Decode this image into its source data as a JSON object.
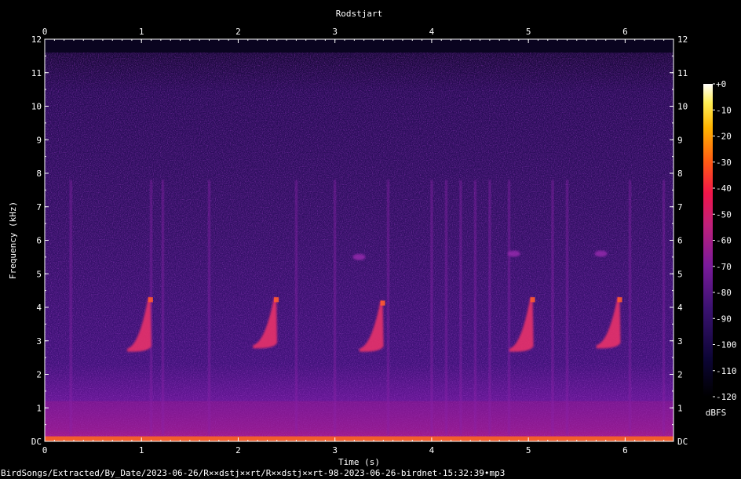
{
  "chart_data": {
    "type": "heatmap",
    "title": "Rodstjart",
    "xlabel": "Time (s)",
    "ylabel": "Frequency (kHz)",
    "xlim": [
      0,
      6.5
    ],
    "ylim": [
      0,
      12
    ],
    "x_ticks": [
      "0",
      "1",
      "2",
      "3",
      "4",
      "5",
      "6"
    ],
    "y_ticks": [
      "DC",
      "1",
      "2",
      "3",
      "4",
      "5",
      "6",
      "7",
      "8",
      "9",
      "10",
      "11",
      "12"
    ],
    "colorbar": {
      "label": "dBFS",
      "ticks": [
        "+0",
        "-10",
        "-20",
        "-30",
        "-40",
        "-50",
        "-60",
        "-70",
        "-80",
        "-90",
        "-100",
        "-110",
        "-120"
      ],
      "range_db": [
        -120,
        0
      ]
    },
    "colors": {
      "background": "#000000",
      "noise": "#3a1270",
      "mid": "#7a1a9a",
      "call": "#e8306a",
      "hot": "#ff6a1a"
    },
    "song_calls": [
      {
        "t": 0.95,
        "f_low": 2.7,
        "f_high": 4.3
      },
      {
        "t": 2.25,
        "f_low": 2.8,
        "f_high": 4.3
      },
      {
        "t": 3.35,
        "f_low": 2.7,
        "f_high": 4.2
      },
      {
        "t": 4.9,
        "f_low": 2.7,
        "f_high": 4.3
      },
      {
        "t": 5.8,
        "f_low": 2.8,
        "f_high": 4.3
      }
    ],
    "clicks": [
      0.27,
      1.1,
      1.22,
      1.7,
      2.6,
      3.0,
      3.55,
      4.0,
      4.15,
      4.3,
      4.45,
      4.6,
      4.8,
      5.25,
      5.4,
      6.05,
      6.4
    ],
    "chirps": [
      {
        "t": 3.25,
        "f": 5.5
      },
      {
        "t": 4.85,
        "f": 5.6
      },
      {
        "t": 5.75,
        "f": 5.6
      }
    ],
    "low_band_khz": [
      0,
      1.2
    ]
  },
  "footer": {
    "filename": "BirdSongs/Extracted/By_Date/2023-06-26/R××dstj××rt/R××dstj××rt-98-2023-06-26-birdnet-15:32:39•mp3"
  }
}
